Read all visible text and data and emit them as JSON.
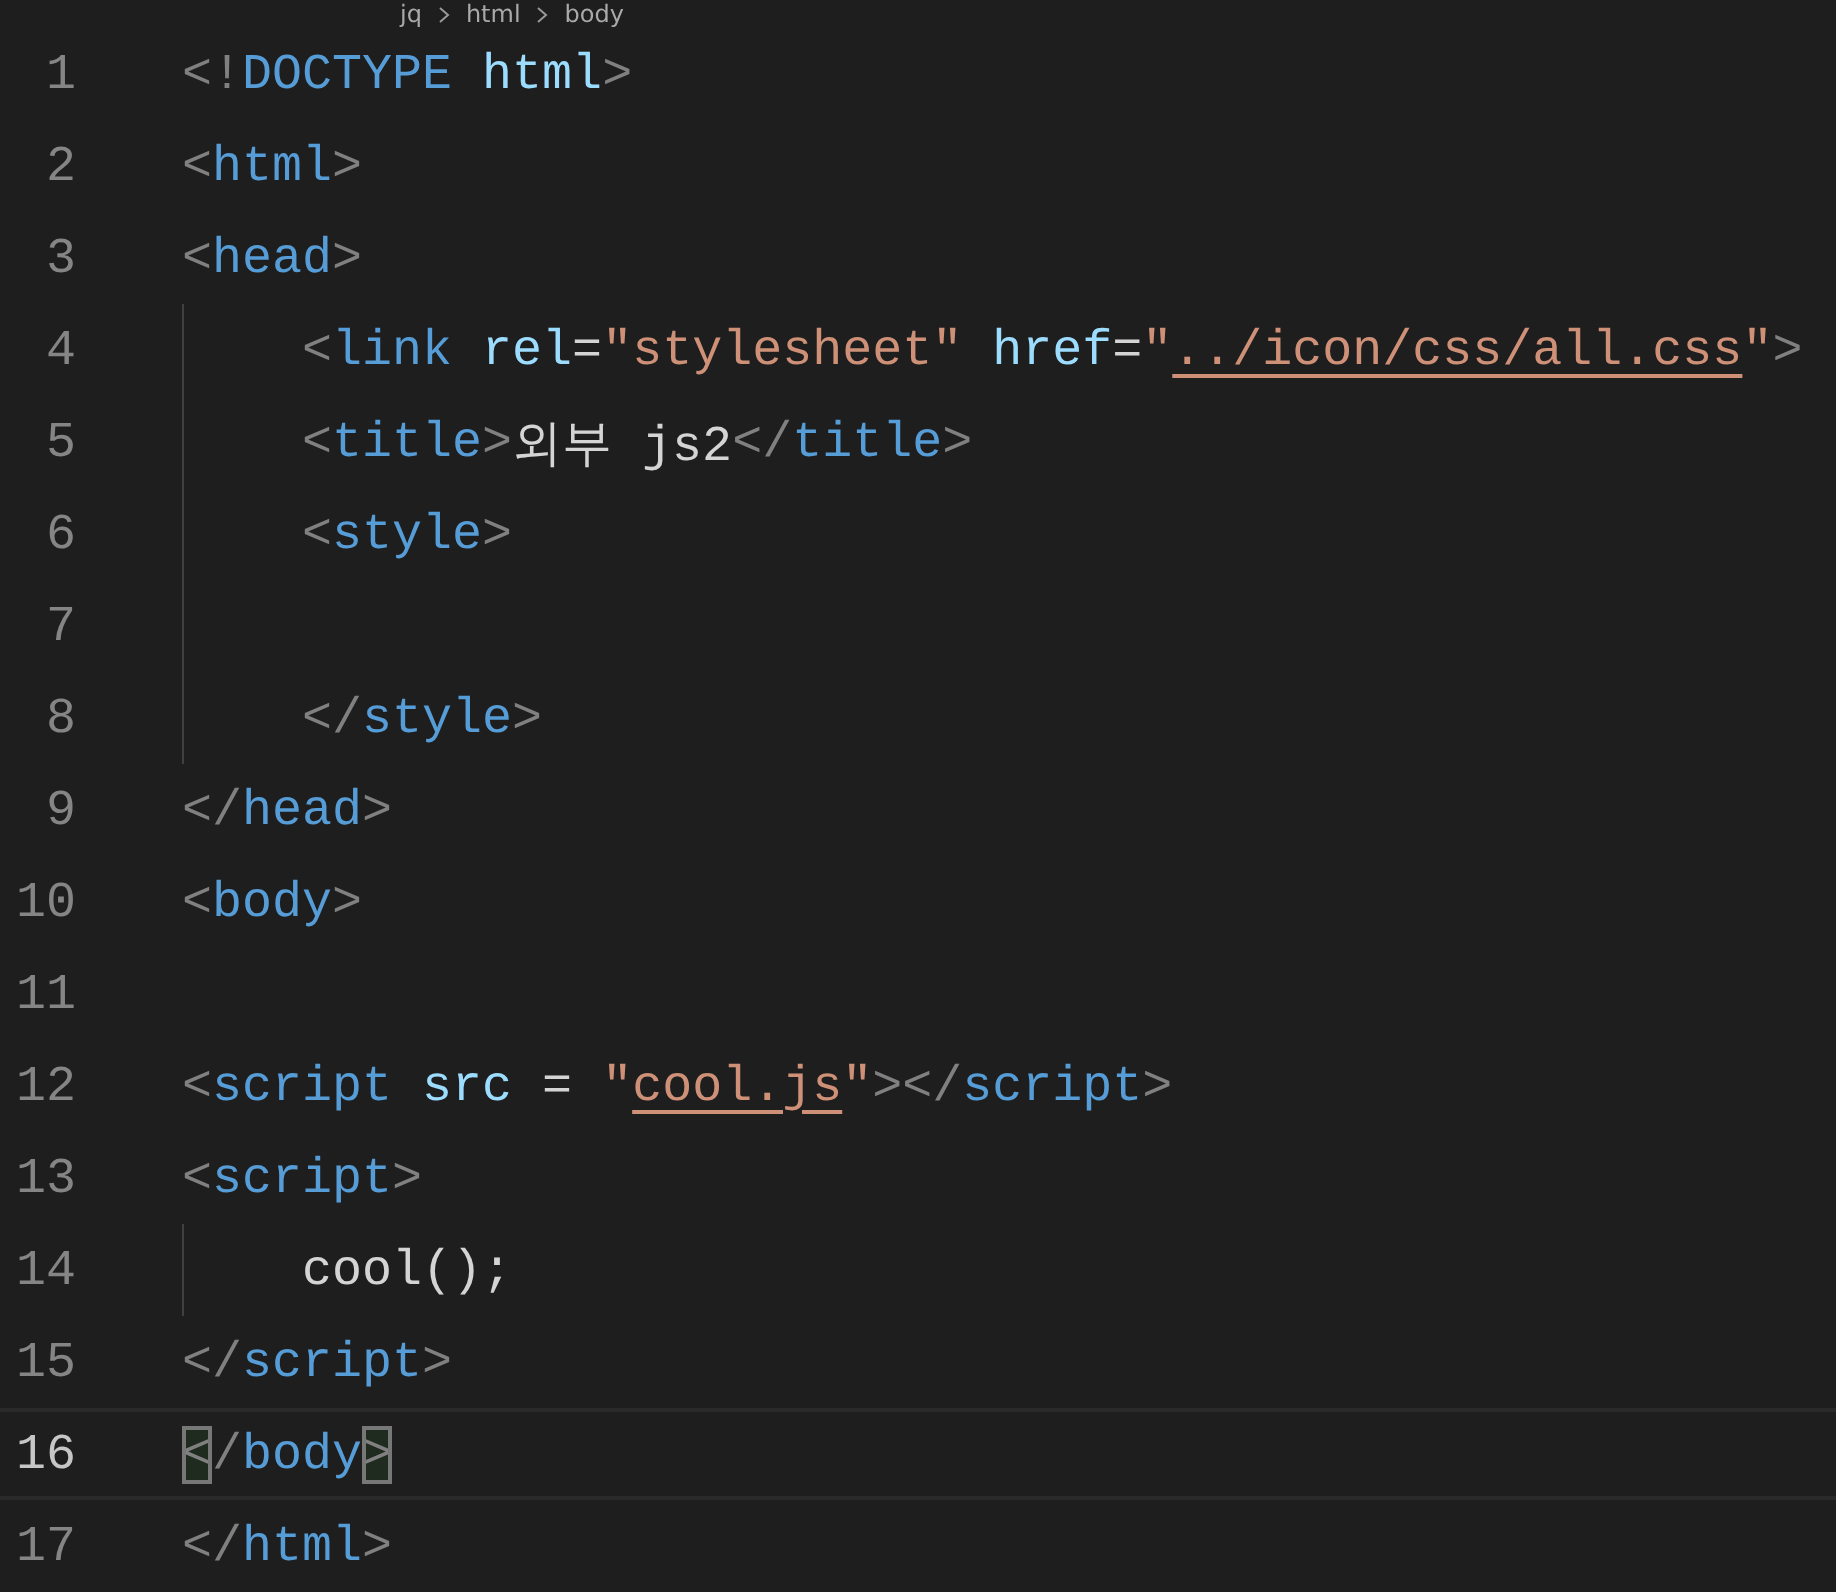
{
  "breadcrumb": [
    {
      "label": "jq"
    },
    {
      "label": "html"
    },
    {
      "label": "body"
    }
  ],
  "lines": [
    {
      "number": "1",
      "current": false,
      "indented": false,
      "tokens": [
        {
          "kind": "punct",
          "text": "<!"
        },
        {
          "kind": "tag",
          "text": "DOCTYPE"
        },
        {
          "kind": "attr",
          "text": " html"
        },
        {
          "kind": "punct",
          "text": ">"
        }
      ]
    },
    {
      "number": "2",
      "current": false,
      "indented": false,
      "tokens": [
        {
          "kind": "punct",
          "text": "<"
        },
        {
          "kind": "tag",
          "text": "html"
        },
        {
          "kind": "punct",
          "text": ">"
        }
      ]
    },
    {
      "number": "3",
      "current": false,
      "indented": false,
      "tokens": [
        {
          "kind": "punct",
          "text": "<"
        },
        {
          "kind": "tag",
          "text": "head"
        },
        {
          "kind": "punct",
          "text": ">"
        }
      ]
    },
    {
      "number": "4",
      "current": false,
      "indented": true,
      "tokens": [
        {
          "kind": "punct",
          "text": "<"
        },
        {
          "kind": "tag",
          "text": "link"
        },
        {
          "kind": "attr",
          "text": " rel"
        },
        {
          "kind": "text",
          "text": "="
        },
        {
          "kind": "string",
          "text": "\"stylesheet\""
        },
        {
          "kind": "attr",
          "text": " href"
        },
        {
          "kind": "text",
          "text": "="
        },
        {
          "kind": "string",
          "text": "\""
        },
        {
          "kind": "link",
          "text": "../icon/css/all.css"
        },
        {
          "kind": "string",
          "text": "\""
        },
        {
          "kind": "punct",
          "text": ">"
        }
      ]
    },
    {
      "number": "5",
      "current": false,
      "indented": true,
      "tokens": [
        {
          "kind": "punct",
          "text": "<"
        },
        {
          "kind": "tag",
          "text": "title"
        },
        {
          "kind": "punct",
          "text": ">"
        },
        {
          "kind": "text",
          "text": "외부 js2"
        },
        {
          "kind": "punct",
          "text": "</"
        },
        {
          "kind": "tag",
          "text": "title"
        },
        {
          "kind": "punct",
          "text": ">"
        }
      ]
    },
    {
      "number": "6",
      "current": false,
      "indented": true,
      "tokens": [
        {
          "kind": "punct",
          "text": "<"
        },
        {
          "kind": "tag",
          "text": "style"
        },
        {
          "kind": "punct",
          "text": ">"
        }
      ]
    },
    {
      "number": "7",
      "current": false,
      "indented": true
    },
    {
      "number": "8",
      "current": false,
      "indented": true,
      "tokens": [
        {
          "kind": "punct",
          "text": "</"
        },
        {
          "kind": "tag",
          "text": "style"
        },
        {
          "kind": "punct",
          "text": ">"
        }
      ]
    },
    {
      "number": "9",
      "current": false,
      "indented": false,
      "tokens": [
        {
          "kind": "punct",
          "text": "</"
        },
        {
          "kind": "tag",
          "text": "head"
        },
        {
          "kind": "punct",
          "text": ">"
        }
      ]
    },
    {
      "number": "10",
      "current": false,
      "indented": false,
      "tokens": [
        {
          "kind": "punct",
          "text": "<"
        },
        {
          "kind": "tag",
          "text": "body"
        },
        {
          "kind": "punct",
          "text": ">"
        }
      ]
    },
    {
      "number": "11",
      "current": false,
      "indented": false
    },
    {
      "number": "12",
      "current": false,
      "indented": false,
      "tokens": [
        {
          "kind": "punct",
          "text": "<"
        },
        {
          "kind": "tag",
          "text": "script"
        },
        {
          "kind": "attr",
          "text": " src"
        },
        {
          "kind": "text",
          "text": " = "
        },
        {
          "kind": "string",
          "text": "\""
        },
        {
          "kind": "link",
          "text": "cool.js"
        },
        {
          "kind": "string",
          "text": "\""
        },
        {
          "kind": "punct",
          "text": "></"
        },
        {
          "kind": "tag",
          "text": "script"
        },
        {
          "kind": "punct",
          "text": ">"
        }
      ]
    },
    {
      "number": "13",
      "current": false,
      "indented": false,
      "tokens": [
        {
          "kind": "punct",
          "text": "<"
        },
        {
          "kind": "tag",
          "text": "script"
        },
        {
          "kind": "punct",
          "text": ">"
        }
      ]
    },
    {
      "number": "14",
      "current": false,
      "indented": true,
      "tokens": [
        {
          "kind": "text",
          "text": "cool();"
        }
      ]
    },
    {
      "number": "15",
      "current": false,
      "indented": false,
      "tokens": [
        {
          "kind": "punct",
          "text": "</"
        },
        {
          "kind": "tag",
          "text": "script"
        },
        {
          "kind": "punct",
          "text": ">"
        }
      ]
    },
    {
      "number": "16",
      "current": true,
      "indented": false,
      "tokens": [
        {
          "kind": "match",
          "text": "<"
        },
        {
          "kind": "punct",
          "text": "/"
        },
        {
          "kind": "tag",
          "text": "body"
        },
        {
          "kind": "match",
          "text": ">"
        }
      ]
    },
    {
      "number": "17",
      "current": false,
      "indented": false,
      "tokens": [
        {
          "kind": "punct",
          "text": "</"
        },
        {
          "kind": "tag",
          "text": "html"
        },
        {
          "kind": "punct",
          "text": ">"
        }
      ]
    }
  ]
}
